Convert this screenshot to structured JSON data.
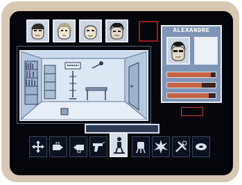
{
  "character": {
    "name": "ALEXANDRE",
    "stats": [
      0.9,
      0.72,
      0.86
    ]
  },
  "counter": {
    "value": ""
  },
  "party": [
    {
      "name": "portrait-1"
    },
    {
      "name": "portrait-2"
    },
    {
      "name": "portrait-3"
    },
    {
      "name": "portrait-4"
    }
  ],
  "actions": [
    {
      "icon": "move-cross-icon"
    },
    {
      "icon": "take-hand-icon"
    },
    {
      "icon": "give-hand-icon"
    },
    {
      "icon": "gun-icon"
    },
    {
      "icon": "stand-figure-icon"
    },
    {
      "icon": "fist-icon"
    },
    {
      "icon": "explosion-icon"
    },
    {
      "icon": "repair-tools-icon"
    },
    {
      "icon": "disk-icon"
    }
  ],
  "colors": {
    "screen": "#06070c",
    "panel": "#7e95b6",
    "accent": "#c56347",
    "frame": "#d7c7b3"
  }
}
